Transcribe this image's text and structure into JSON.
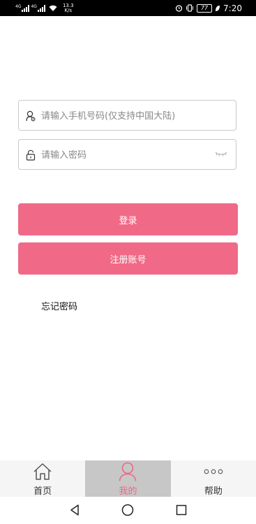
{
  "status_bar": {
    "signal1_tag": "4G",
    "signal2_tag": "4G",
    "net_speed_value": "13.3",
    "net_speed_unit": "K/s",
    "battery": "77",
    "time": "7:20"
  },
  "login": {
    "phone_placeholder": "请输入手机号码(仅支持中国大陆)",
    "password_placeholder": "请输入密码",
    "login_label": "登录",
    "register_label": "注册账号",
    "forgot_label": "忘记密码"
  },
  "tabs": [
    {
      "label": "首页",
      "icon": "home-icon"
    },
    {
      "label": "我的",
      "icon": "person-icon"
    },
    {
      "label": "帮助",
      "icon": "more-dots-icon"
    }
  ],
  "colors": {
    "accent": "#f06a87",
    "tab_active_bg": "#c7c7c7",
    "tab_active_text": "#e86a89"
  },
  "nav": [
    "back-icon",
    "home-circle-icon",
    "recents-square-icon"
  ]
}
